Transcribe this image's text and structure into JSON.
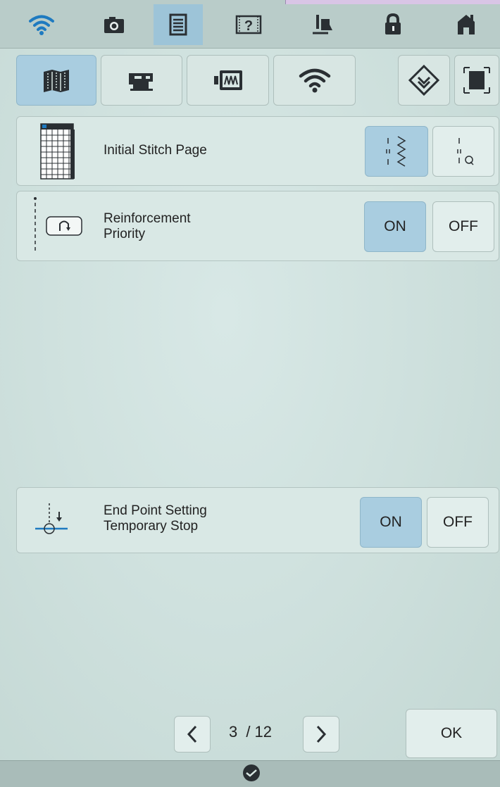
{
  "toolbar": {
    "items": [
      {
        "icon": "wifi-icon"
      },
      {
        "icon": "camera-icon"
      },
      {
        "icon": "settings-page-icon",
        "active": true
      },
      {
        "icon": "help-icon"
      },
      {
        "icon": "presser-foot-icon"
      },
      {
        "icon": "lock-icon"
      },
      {
        "icon": "home-icon"
      }
    ]
  },
  "tabs": [
    {
      "icon": "general-settings-icon",
      "active": true
    },
    {
      "icon": "sewing-machine-icon"
    },
    {
      "icon": "embroidery-frame-icon"
    },
    {
      "icon": "wireless-icon"
    },
    {
      "icon": "stitch-pattern-icon"
    },
    {
      "icon": "screen-display-icon"
    }
  ],
  "settings": {
    "initial_stitch_page": {
      "label": "Initial Stitch Page",
      "option_a_icon": "utility-stitch-icon",
      "option_b_icon": "quilt-stitch-icon",
      "selected": "utility-stitch"
    },
    "reinforcement_priority": {
      "label_line1": "Reinforcement",
      "label_line2": "Priority",
      "on_label": "ON",
      "off_label": "OFF",
      "selected": "ON"
    },
    "end_point_setting": {
      "label_line1": "End Point Setting",
      "label_line2": "Temporary Stop",
      "on_label": "ON",
      "off_label": "OFF",
      "selected": "ON"
    }
  },
  "pagination": {
    "current": "3",
    "separator": "/",
    "total": "12"
  },
  "ok_label": "OK",
  "colors": {
    "accent_selected": "#a9cde0",
    "icon_blue": "#1e7ac0",
    "background": "#cfe1de"
  }
}
